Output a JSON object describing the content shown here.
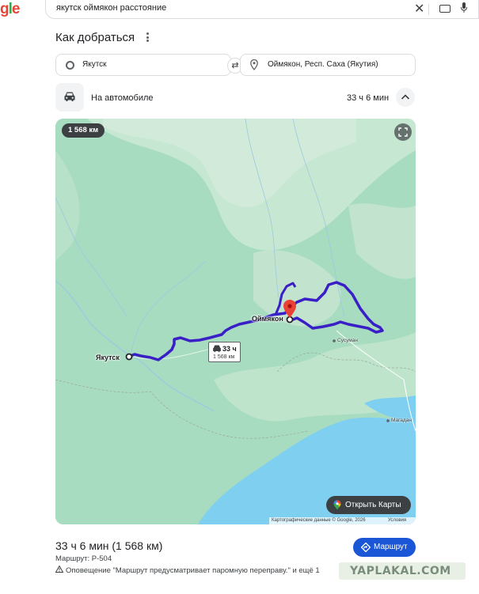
{
  "search": {
    "query": "якутск оймякон расстояние"
  },
  "logo": {
    "text_g": "g",
    "text_l": "l",
    "text_e": "e"
  },
  "directions": {
    "title": "Как добраться",
    "from": "Якутск",
    "to": "Оймякон, Респ. Саха (Якутия)",
    "mode_label": "На автомобиле",
    "mode_time": "33 ч 6 мин"
  },
  "map": {
    "distance_chip": "1 568 км",
    "cities": {
      "yakutsk": "Якутск",
      "oymyakon": "Оймякон",
      "susuman": "Сусуман",
      "magadan": "Магадан"
    },
    "badge": {
      "time": "33 ч",
      "distance": "1 568 км"
    },
    "open_maps_label": "Открыть Карты",
    "attribution": "Картографические данные © Google, 2026",
    "terms": "Условия",
    "colors": {
      "route": "#3a1fc7",
      "land": "#a8dcc1",
      "water": "#7ecff0",
      "pin": "#ea4335"
    }
  },
  "result": {
    "summary": "33 ч 6 мин (1 568 км)",
    "road": "Маршрут: P-504",
    "warning": "Оповещение \"Маршрут предусматривает паромную переправу.\" и ещё 1",
    "route_button": "Маршрут"
  },
  "watermark": "YAPLAKAL.COM"
}
